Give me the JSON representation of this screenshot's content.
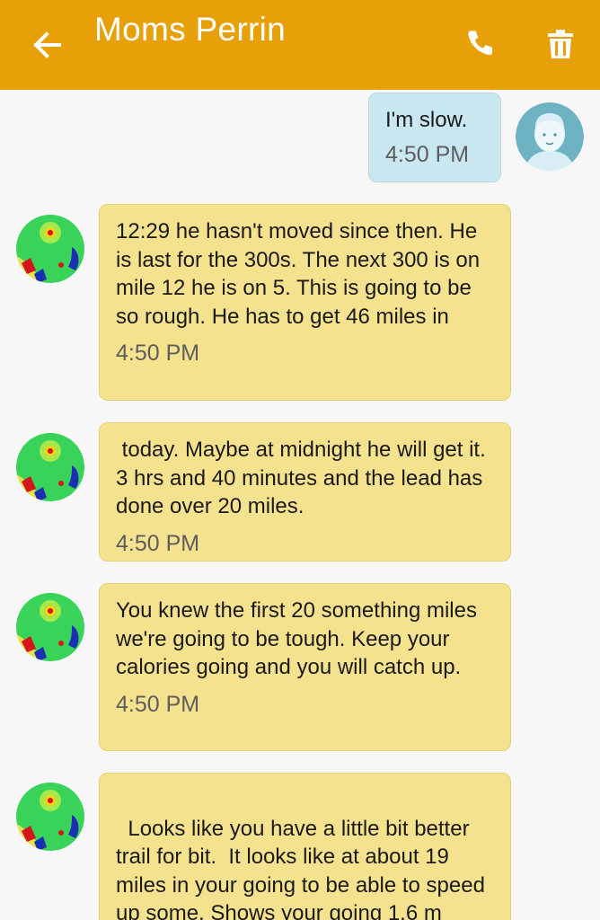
{
  "header": {
    "title": "Moms Perrin",
    "back_icon": "arrow-left-icon",
    "call_icon": "phone-icon",
    "delete_icon": "trash-icon",
    "background": "#e8a009"
  },
  "messages": [
    {
      "direction": "sent",
      "text": "I'm slow.",
      "time": "4:50 PM"
    },
    {
      "direction": "received",
      "text": "12:29 he hasn't moved since then. He is last for the 300s. The next 300 is on mile 12 he is on 5. This is going to be so rough. He has to get 46 miles in",
      "time": "4:50 PM"
    },
    {
      "direction": "received",
      "text": " today. Maybe at midnight he will get it. 3 hrs and 40 minutes and the lead has done over 20 miles.",
      "time": "4:50 PM"
    },
    {
      "direction": "received",
      "text": "You knew the first 20 something miles we're going to be tough. Keep your calories going and you will catch up.",
      "time": "4:50 PM"
    },
    {
      "direction": "received",
      "text": "Looks like you have a little bit better trail for bit.  It looks like at about 19 miles in your going to be able to speed up some. Shows your going 1.6 m",
      "time": ""
    }
  ],
  "colors": {
    "sent_bubble": "#c9e7f0",
    "received_bubble": "#f5e28e",
    "background": "#f7f7f7"
  }
}
